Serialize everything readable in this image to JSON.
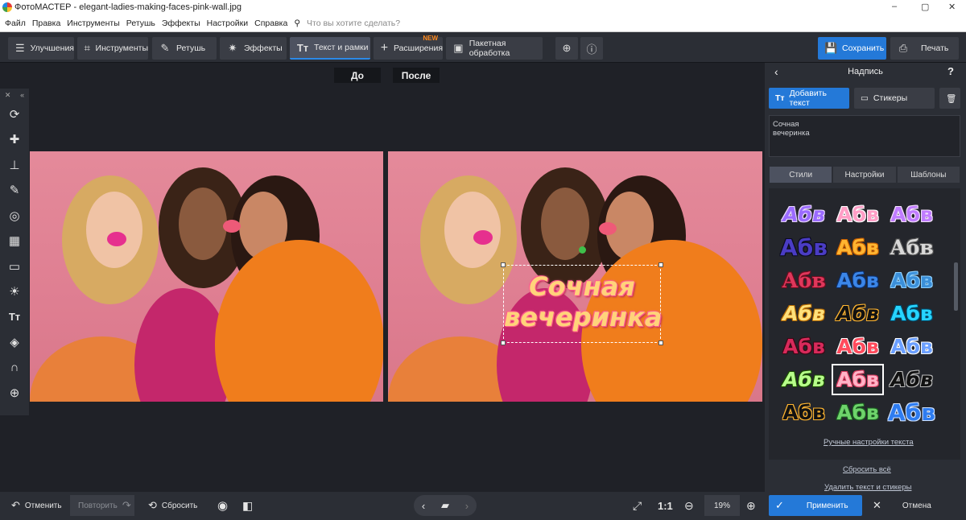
{
  "window": {
    "title": "ФотоМАСТЕР - elegant-ladies-making-faces-pink-wall.jpg",
    "minimize": "–",
    "maximize": "▢",
    "close": "✕"
  },
  "menu": {
    "items": [
      "Файл",
      "Правка",
      "Инструменты",
      "Ретушь",
      "Эффекты",
      "Настройки",
      "Справка"
    ],
    "search_placeholder": "Что вы хотите сделать?"
  },
  "toolbar": {
    "tabs": [
      {
        "label": "Улучшения",
        "icon": "sliders-icon"
      },
      {
        "label": "Инструменты",
        "icon": "crop-icon"
      },
      {
        "label": "Ретушь",
        "icon": "brush-icon"
      },
      {
        "label": "Эффекты",
        "icon": "magic-wand-icon"
      },
      {
        "label": "Текст и рамки",
        "icon": "text-icon",
        "active": true
      },
      {
        "label": "Расширения",
        "icon": "plus-icon",
        "badge": "NEW"
      },
      {
        "label": "Пакетная обработка",
        "icon": "batch-icon"
      }
    ],
    "save_label": "Сохранить",
    "print_label": "Печать"
  },
  "compare": {
    "before": "До",
    "after": "После"
  },
  "overlay": {
    "line1": "Сочная",
    "line2": "вечеринка"
  },
  "right_panel": {
    "title": "Надпись",
    "help": "?",
    "add_text": "Добавить текст",
    "stickers": "Стикеры",
    "textarea_line1": "Сочная",
    "textarea_line2": "вечеринка",
    "tabs": [
      "Стили",
      "Настройки",
      "Шаблоны"
    ],
    "active_tab": "Стили",
    "style_sample": "Абв",
    "manual_link": "Ручные настройки текста",
    "reset_all": "Сбросить всё",
    "delete_link": "Удалить текст и стикеры"
  },
  "bottom": {
    "undo": "Отменить",
    "redo": "Повторить",
    "reset": "Сбросить",
    "zoom_one": "1:1",
    "zoom": "19%",
    "apply": "Применить",
    "cancel": "Отмена"
  }
}
